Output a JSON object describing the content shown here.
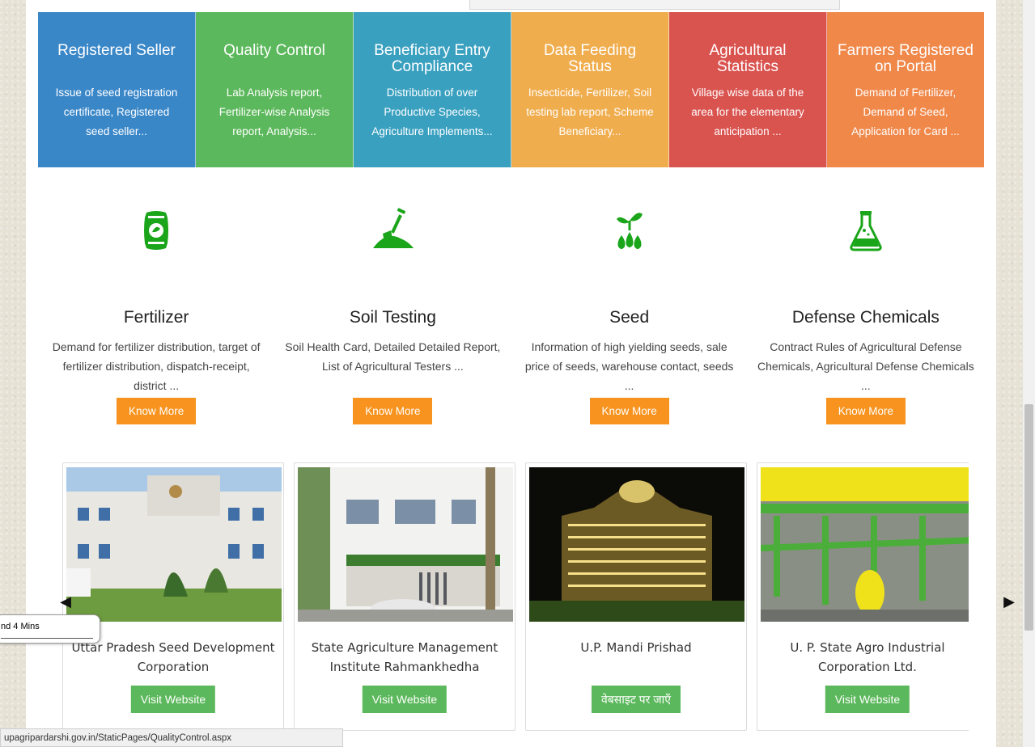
{
  "tiles": [
    {
      "title": "Registered Seller",
      "desc": "Issue of seed registration certificate, Registered seed seller...",
      "color": "#3a87c8"
    },
    {
      "title": "Quality Control",
      "desc": "Lab Analysis report, Fertilizer-wise Analysis report, Analysis...",
      "color": "#5cb85c"
    },
    {
      "title": "Beneficiary Entry Compliance",
      "desc": "Distribution of over Productive Species, Agriculture Implements...",
      "color": "#3aa0c0"
    },
    {
      "title": "Data Feeding Status",
      "desc": "Insecticide, Fertilizer, Soil testing lab report, Scheme Beneficiary...",
      "color": "#f0ad4e"
    },
    {
      "title": "Agricultural Statistics",
      "desc": "Village wise data of the area for the elementary anticipation ...",
      "color": "#d9534f"
    },
    {
      "title": "Farmers Registered on Portal",
      "desc": "Demand of Fertilizer, Demand of Seed, Application for Card ...",
      "color": "#f0884a"
    }
  ],
  "features": [
    {
      "title": "Fertilizer",
      "desc": "Demand for fertilizer distribution, target of fertilizer distribution, dispatch-receipt, district ...",
      "button": "Know More",
      "icon": "fertilizer-bag-icon"
    },
    {
      "title": "Soil Testing",
      "desc": "Soil Health Card, Detailed Detailed Report, List of Agricultural Testers ...",
      "button": "Know More",
      "icon": "shovel-soil-icon"
    },
    {
      "title": "Seed",
      "desc": "Information of high yielding seeds, sale price of seeds, warehouse contact, seeds ...",
      "button": "Know More",
      "icon": "seed-sprout-icon"
    },
    {
      "title": "Defense Chemicals",
      "desc": "Contract Rules of Agricultural Defense Chemicals, Agricultural Defense Chemicals ...",
      "button": "Know More",
      "icon": "flask-icon"
    }
  ],
  "accent_green": "#1aa51a",
  "accent_orange": "#f7931e",
  "cards": [
    {
      "title": "Uttar Pradesh Seed Development Corporation",
      "button": "Visit Website"
    },
    {
      "title": "State Agriculture Management Institute Rahmankhedha",
      "button": "Visit Website"
    },
    {
      "title": "U.P. Mandi Prishad",
      "button": "वेबसाइट पर जाएँ"
    },
    {
      "title": "U. P. State Agro Industrial Corporation Ltd.",
      "button": "Visit Website"
    }
  ],
  "timer": {
    "text": "nd 4 Mins"
  },
  "status_url": "upagripardarshi.gov.in/StaticPages/QualityControl.aspx"
}
